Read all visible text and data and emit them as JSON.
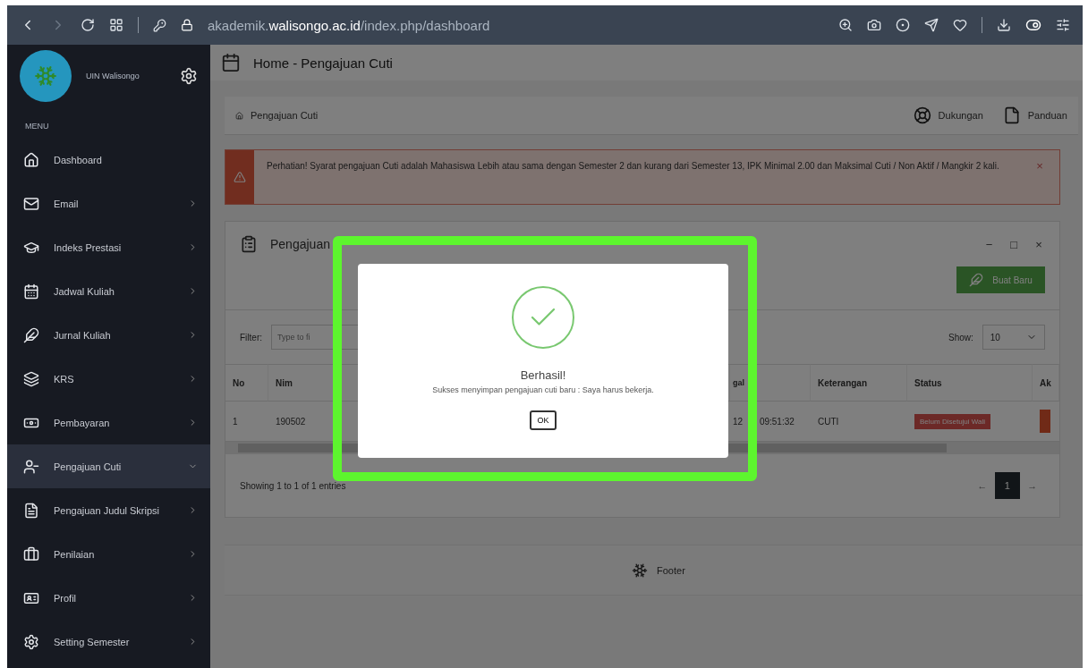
{
  "browser": {
    "url": "akademik.**walisongo.ac.id**/index.php/dashboard"
  },
  "sidebar": {
    "profile_subtitle": "UIN Walisongo",
    "section_label": "MENU",
    "items": [
      {
        "label": "Dashboard",
        "kind": "link",
        "expanded": false,
        "selected": false
      },
      {
        "label": "Email",
        "kind": "submenu",
        "expanded": false,
        "selected": false
      },
      {
        "label": "Indeks Prestasi",
        "kind": "submenu",
        "expanded": false,
        "selected": false
      },
      {
        "label": "Jadwal Kuliah",
        "kind": "submenu",
        "expanded": false,
        "selected": false
      },
      {
        "label": "Jurnal Kuliah",
        "kind": "submenu",
        "expanded": false,
        "selected": false
      },
      {
        "label": "KRS",
        "kind": "submenu",
        "expanded": false,
        "selected": false
      },
      {
        "label": "Pembayaran",
        "kind": "submenu",
        "expanded": false,
        "selected": false
      },
      {
        "label": "Pengajuan Cuti",
        "kind": "submenu",
        "expanded": true,
        "selected": true
      },
      {
        "label": "Pengajuan Judul Skripsi",
        "kind": "submenu",
        "expanded": false,
        "selected": false
      },
      {
        "label": "Penilaian",
        "kind": "submenu",
        "expanded": false,
        "selected": false
      },
      {
        "label": "Profil",
        "kind": "submenu",
        "expanded": false,
        "selected": false
      },
      {
        "label": "Setting Semester",
        "kind": "submenu",
        "expanded": false,
        "selected": false
      }
    ]
  },
  "header": {
    "title": "Home - Pengajuan Cuti"
  },
  "breadcrumb": {
    "item": "Pengajuan Cuti",
    "links": [
      "Dukungan",
      "Panduan"
    ]
  },
  "alert": {
    "text": "Perhatian! Syarat pengajuan Cuti adalah Mahasiswa Lebih atau sama dengan Semester 2 dan kurang dari Semester 13, IPK Minimal 2.00 dan Maksimal Cuti / Non Aktif / Mangkir 2 kali.",
    "close": "×"
  },
  "panel": {
    "title": "Pengajuan",
    "tools": [
      "−",
      "□",
      "×"
    ],
    "new_button": "Buat Baru",
    "filter_label": "Filter:",
    "filter_placeholder": "Type to fi",
    "show_label": "Show:",
    "show_value": "10",
    "columns": [
      "No",
      "Nim",
      "gal",
      "Keterangan",
      "Status",
      "Ak"
    ],
    "rows": [
      [
        "1",
        "190502",
        "12 09:51:32",
        "CUTI"
      ]
    ],
    "status_badges": [
      "Belum Disetujui Wali"
    ],
    "info": "Showing 1 to 1 of 1 entries",
    "pages": [
      {
        "label": "←",
        "selected": false
      },
      {
        "label": "1",
        "selected": true
      },
      {
        "label": "→",
        "selected": false
      }
    ]
  },
  "footer": {
    "text": "Footer"
  },
  "dialog": {
    "title": "Berhasil!",
    "message": "Sukses menyimpan pengajuan cuti baru : Saya harus bekerja.",
    "button": "OK"
  }
}
